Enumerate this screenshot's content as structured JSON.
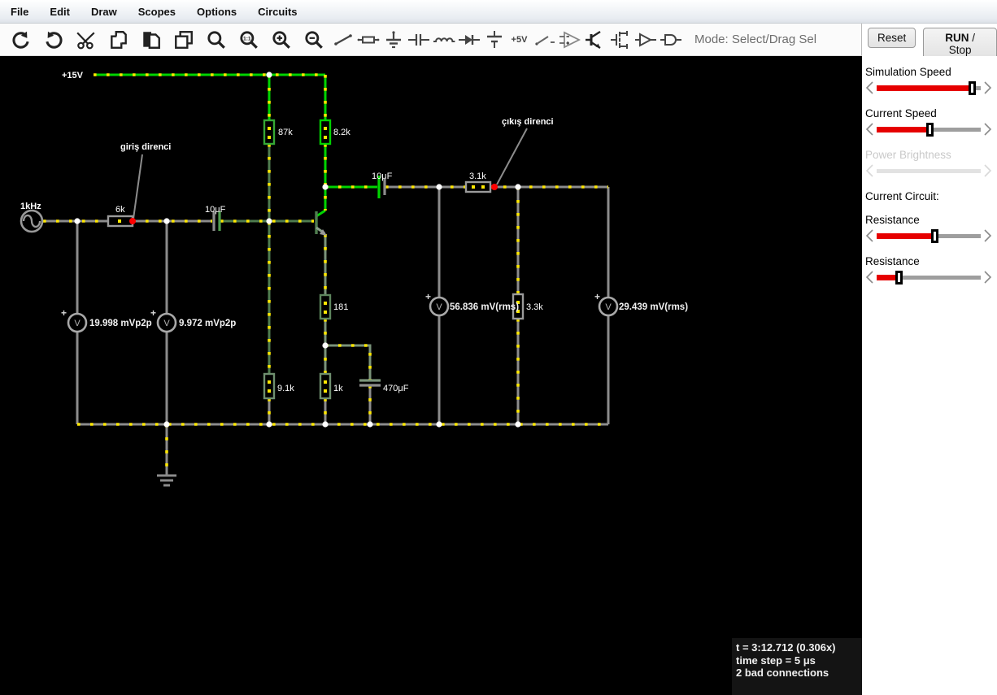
{
  "menu": {
    "items": [
      {
        "label": "File"
      },
      {
        "label": "Edit"
      },
      {
        "label": "Draw"
      },
      {
        "label": "Scopes"
      },
      {
        "label": "Options"
      },
      {
        "label": "Circuits"
      }
    ]
  },
  "toolbar": {
    "mode_label": "Mode: Select/Drag Sel",
    "plus5v_label": "+5V",
    "reset_label": "Reset",
    "run_label": "RUN",
    "run_rest": " / Stop"
  },
  "sidebar": {
    "sliders": [
      {
        "label": "Simulation Speed",
        "value_pct": 93,
        "disabled": false
      },
      {
        "label": "Current Speed",
        "value_pct": 52,
        "disabled": false
      },
      {
        "label": "Power Brightness",
        "value_pct": 0,
        "disabled": true
      },
      {
        "label": "Resistance",
        "value_pct": 57,
        "disabled": false
      },
      {
        "label": "Resistance",
        "value_pct": 23,
        "disabled": false
      }
    ],
    "current_circuit_label": "Current Circuit:"
  },
  "circuit": {
    "supply_label": "+15V",
    "source_label": "1kHz",
    "annotations": {
      "input": "giriş direnci",
      "output": "çıkış direnci"
    },
    "labels": {
      "r_in": "6k",
      "c_in": "10μF",
      "r_b1": "87k",
      "r_c": "8.2k",
      "c_out": "10μF",
      "r_out": "3.1k",
      "r_e1": "181",
      "r_b2": "9.1k",
      "r_e2": "1k",
      "c_e": "470μF",
      "r_load": "3.3k"
    },
    "meters": [
      {
        "symbol": "V",
        "plus": "+",
        "reading": "19.998 mVp2p"
      },
      {
        "symbol": "V",
        "plus": "+",
        "reading": "9.972 mVp2p"
      },
      {
        "symbol": "V",
        "plus": "+",
        "reading": "56.836 mV(rms)"
      },
      {
        "symbol": "V",
        "plus": "+",
        "reading": "29.439 mV(rms)"
      }
    ],
    "colors": {
      "wire_positive": "#00d400",
      "wire_base": "#4f7d4f",
      "wire_emitter": "#7a937a",
      "wire_neutral": "#8c8c8c",
      "current_dot": "#ffe800",
      "junction": "#ffffff",
      "bad_connection": "#ff0000"
    }
  },
  "status": {
    "line1": "t = 3:12.712 (0.306x)",
    "line2": "time step = 5 μs",
    "line3": "2 bad connections"
  }
}
